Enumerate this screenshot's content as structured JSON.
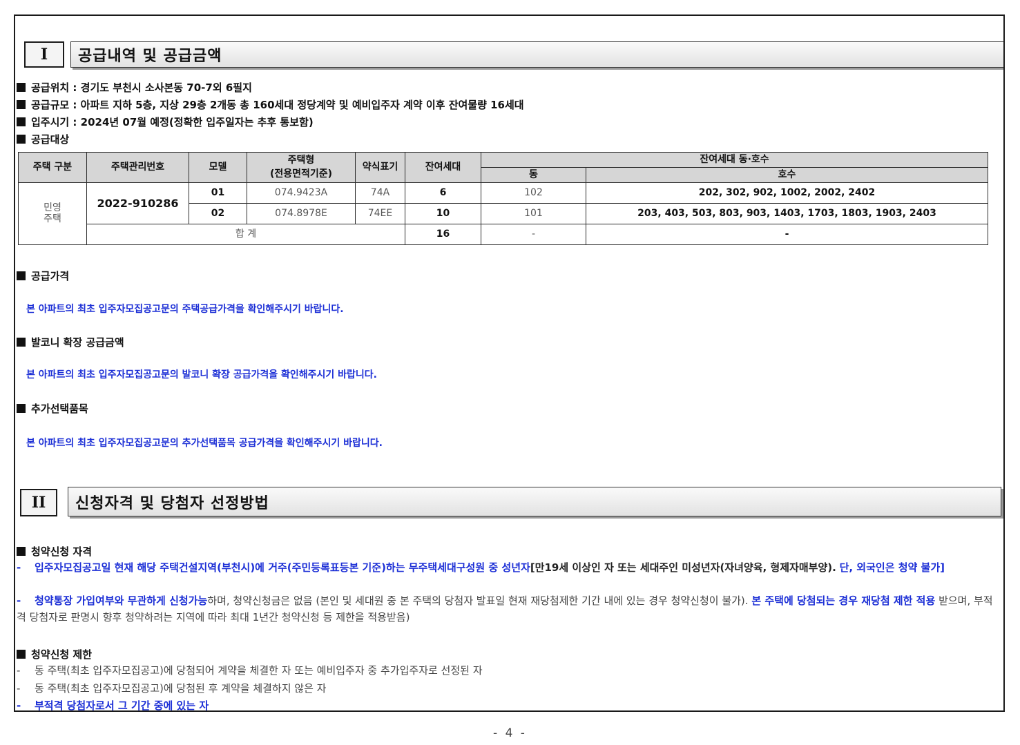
{
  "section1": {
    "number": "I",
    "title": "공급내역 및 공급금액",
    "location": "공급위치 : 경기도 부천시 소사본동 70-7외 6필지",
    "scale": "공급규모 : 아파트 지하 5층, 지상 29층 2개동 총 160세대 정당계약 및 예비입주자 계약 이후 잔여물량 16세대",
    "move_in": "입주시기 : 2024년 07월 예정(정확한 입주일자는 추후 통보함)",
    "target": "공급대상",
    "table": {
      "headers": {
        "type": "주택 구분",
        "mgmt_no": "주택관리번호",
        "model": "모델",
        "housing_type": "주택형",
        "housing_type_sub": "(전용면적기준)",
        "short": "약식표기",
        "remaining": "잔여세대",
        "units": "잔여세대 동·호수",
        "dong": "동",
        "ho": "호수"
      },
      "type_value": "민영 주택",
      "mgmt_value": "2022-910286",
      "rows": [
        {
          "model": "01",
          "housing_type": "074.9423A",
          "short": "74A",
          "remaining": "6",
          "dong": "102",
          "ho": "202, 302, 902, 1002, 2002, 2402"
        },
        {
          "model": "02",
          "housing_type": "074.8978E",
          "short": "74EE",
          "remaining": "10",
          "dong": "101",
          "ho": "203, 403, 503, 803, 903, 1403, 1703, 1803, 1903, 2403"
        }
      ],
      "total": {
        "label": "합 계",
        "remaining": "16",
        "dong": "-",
        "ho": "-"
      }
    },
    "price_heading": "공급가격",
    "price_note": "본 아파트의 최초 입주자모집공고문의 주택공급가격을 확인해주시기 바랍니다.",
    "balcony_heading": "발코니 확장 공급금액",
    "balcony_note": "본 아파트의 최초 입주자모집공고문의 발코니 확장 공급가격을 확인해주시기 바랍니다.",
    "option_heading": "추가선택품목",
    "option_note": "본 아파트의 최초 입주자모집공고문의 추가선택품목 공급가격을 확인해주시기 바랍니다."
  },
  "section2": {
    "number": "II",
    "title": "신청자격 및 당첨자 선정방법",
    "qual_heading": "청약신청 자격",
    "qual_line1_blue": "입주자모집공고일 현재 해당 주택건설지역(부천시)에 거주(주민등록표등본 기준)하는 무주택세대구성원 중 성년자",
    "qual_line1_black": "[만19세 이상인 자 또는 세대주인 미성년자(자녀양육, 형제자매부양).",
    "qual_line1_blue2": "단, 외국인은 청약 불가]",
    "qual_line2_blue": "청약통장 가입여부와 무관하게 신청가능",
    "qual_line2_black": "하며, 청약신청금은 없음 (본인 및 세대원 중 본 주택의 당첨자 발표일 현재 재당첨제한 기간 내에 있는 경우 청약신청이 불가).",
    "qual_line2_blue2": "본 주택에 당첨되는 경우 재당첨 제한 적용",
    "qual_line2_black2": "받으며, 부적격 당첨자로 판명시 향후 청약하려는 지역에 따라 최대 1년간 청약신청 등 제한을 적용받음)",
    "limit_heading": "청약신청 제한",
    "limits": [
      "동 주택(최초 입주자모집공고)에 당첨되어 계약을 체결한 자 또는 예비입주자 중 추가입주자로 선정된 자",
      "동 주택(최초 입주자모집공고)에 당첨된 후 계약을 체결하지 않은 자"
    ],
    "limit_blue": "부적격 당첨자로서 그 기간 중에 있는 자"
  },
  "footer": {
    "page": "- 4 -"
  }
}
